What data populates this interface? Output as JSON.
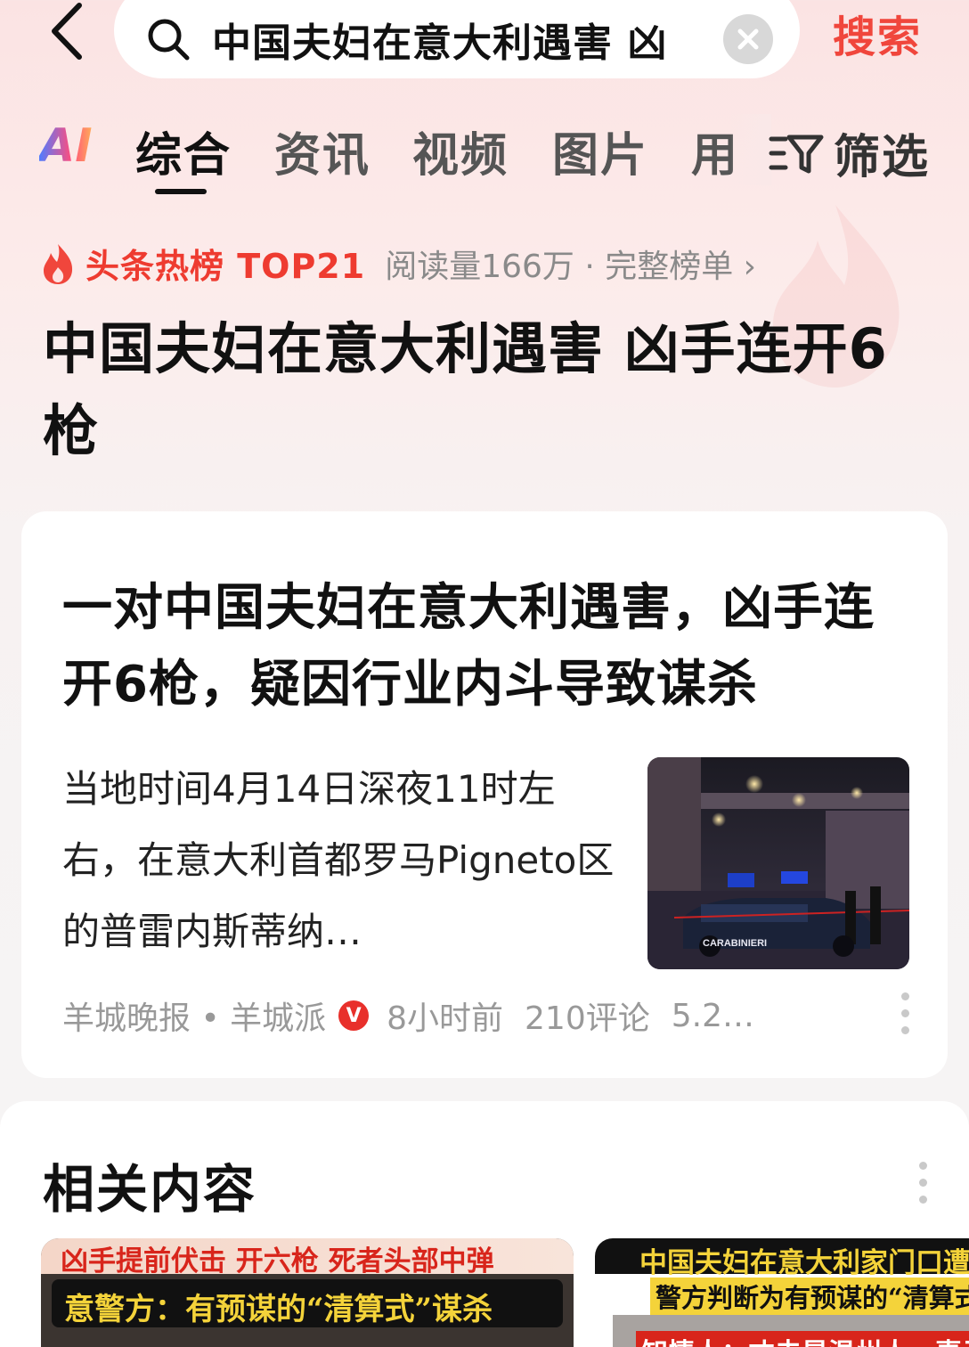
{
  "search": {
    "query": "中国夫妇在意大利遇害 凶",
    "submit_label": "搜索"
  },
  "tabs": {
    "ai_label": "AI",
    "items": [
      "综合",
      "资讯",
      "视频",
      "图片",
      "用"
    ],
    "filter_label": "筛选"
  },
  "hot": {
    "label": "头条热榜 TOP21",
    "meta": "阅读量166万 · 完整榜单 ›",
    "title": "中国夫妇在意大利遇害 凶手连开6枪"
  },
  "article": {
    "title": "一对中国夫妇在意大利遇害，凶手连开6枪，疑因行业内斗导致谋杀",
    "summary": "当地时间4月14日深夜11时左右，在意大利首都罗马Pigneto区的普雷内斯蒂纳…",
    "source": "羊城晚报 • 羊城派",
    "badge": "V",
    "time": "8小时前",
    "comments": "210评论",
    "reads": "5.2…",
    "thumb_text": "CARABINIERI"
  },
  "related": {
    "title": "相关内容",
    "items": [
      {
        "line1": "凶手提前伏击 开六枪 死者头部中弹",
        "line2": "意警方：有预谋的“清算式”谋杀"
      },
      {
        "line1": "中国夫妇在意大利家门口遭",
        "line2": "警方判断为有预谋的“清算式",
        "line3": "知情人：丈夫是温州人，妻子"
      }
    ]
  }
}
